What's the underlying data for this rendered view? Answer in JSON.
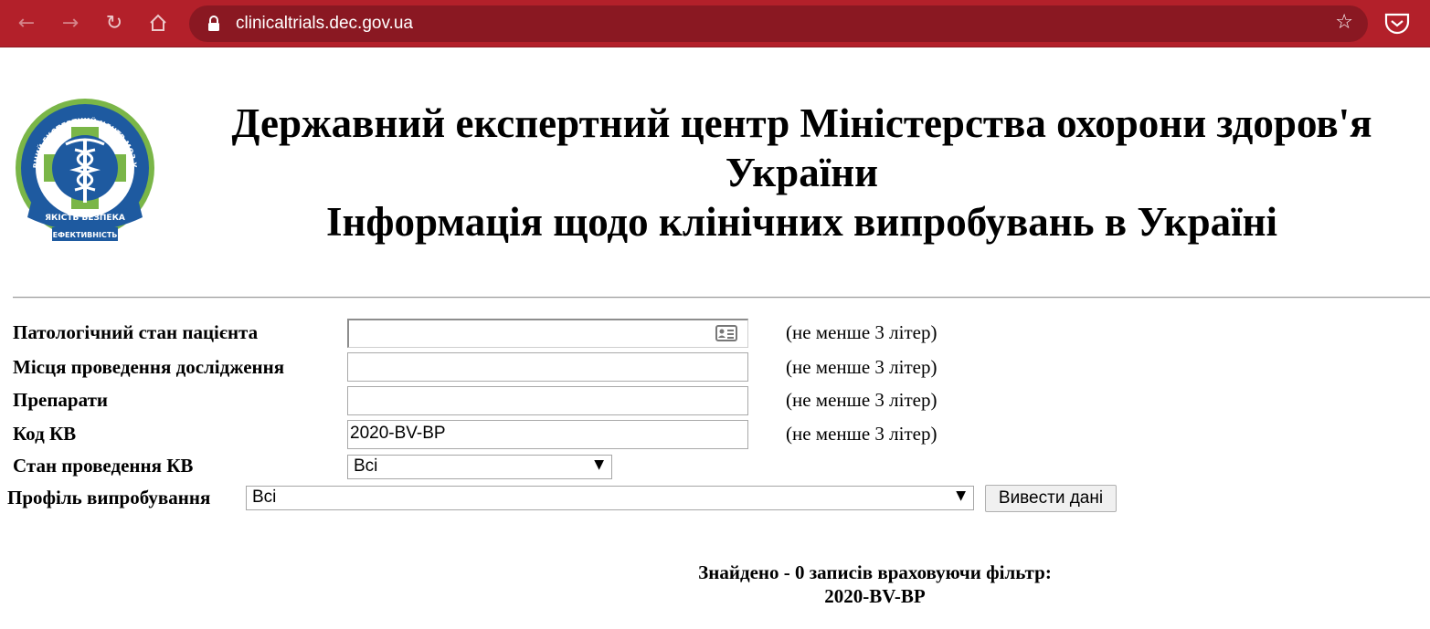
{
  "browser": {
    "url": "clinicaltrials.dec.gov.ua",
    "toolbar_color": "#b3202a"
  },
  "header": {
    "title_line1": "Державний експертний центр Міністерства охорони здоров'я",
    "title_line2": "України",
    "title_line3": "Інформація щодо клінічних випробувань в Україні",
    "logo_text_top": "ДЕРЖАВНИЙ ЕКСПЕРТНИЙ ЦЕНТР МОЗ УКРАЇНИ",
    "logo_text_ribbon": "ЯКІСТЬ БЕЗПЕКА",
    "logo_text_bottom": "ЕФЕКТИВНІСТЬ"
  },
  "form": {
    "condition_label": "Патологічний стан пацієнта",
    "condition_value": "",
    "sites_label": "Місця проведення дослідження",
    "sites_value": "",
    "drugs_label": "Препарати",
    "drugs_value": "",
    "code_label": "Код КВ",
    "code_value": "2020-BV-BP",
    "hint": "(не менше 3 літер)",
    "status_label": "Стан проведення КВ",
    "status_value": "Всі",
    "profile_label": "Профіль випробування",
    "profile_value": "Всі",
    "submit_label": "Вивести дані"
  },
  "result": {
    "summary": "Знайдено - 0 записів враховуючи фільтр:",
    "filter": "2020-BV-BP"
  }
}
